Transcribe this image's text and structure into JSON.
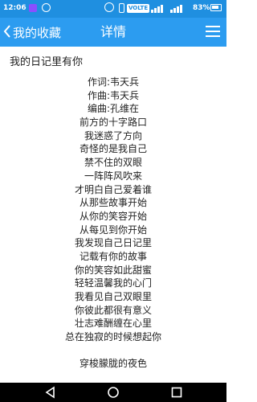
{
  "status_bar": {
    "time": "12:06",
    "volte_label": "VOLTE",
    "battery_percent": "83%"
  },
  "header": {
    "back_label": "我的收藏",
    "title": "详情"
  },
  "song": {
    "title": "我的日记里有你",
    "lyrics": [
      "作词:韦天兵",
      "作曲:韦天兵",
      "编曲:孔维在",
      "前方的十字路口",
      "我迷惑了方向",
      "奇怪的是我自己",
      "禁不住的双眼",
      "一阵阵风吹来",
      "才明白自己爱着谁",
      "从那些故事开始",
      "从你的笑容开始",
      "从每见到你开始",
      "我发现自己日记里",
      "记载有你的故事",
      "你的笑容如此甜蜜",
      "轻轻温馨我的心门",
      "我看见自己双眼里",
      "你彼此都很有意义",
      "壮志难酬缠在心里",
      "总在独寂的时候想起你",
      "",
      "穿梭朦胧的夜色"
    ]
  },
  "colors": {
    "status_bar_bg": "#1f8fe0",
    "nav_bar_bg": "#2c9cf0",
    "text": "#222222"
  },
  "icons": {
    "back": "chevron-left-icon",
    "menu": "hamburger-menu-icon",
    "system_back": "triangle-back-icon",
    "system_home": "circle-home-icon",
    "system_recent": "square-recent-icon"
  }
}
